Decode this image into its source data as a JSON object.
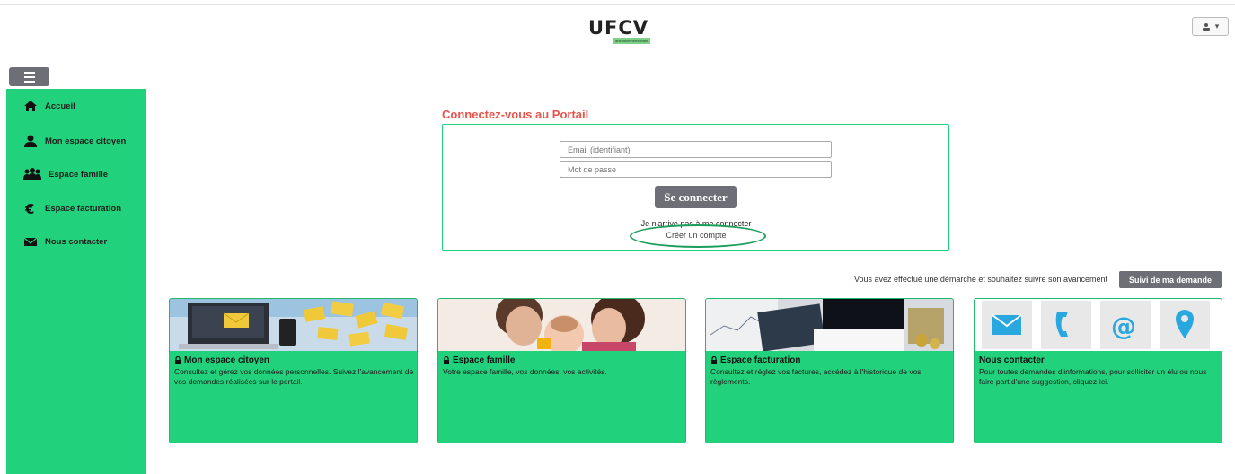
{
  "header": {
    "logo_text": "UFCV",
    "logo_sub": "animation territoriale",
    "user_menu_caret": "▾"
  },
  "sidebar": {
    "items": [
      {
        "label": "Accueil",
        "icon": "home-icon"
      },
      {
        "label": "Mon espace citoyen",
        "icon": "user-icon"
      },
      {
        "label": "Espace famille",
        "icon": "family-icon"
      },
      {
        "label": "Espace facturation",
        "icon": "euro-icon"
      },
      {
        "label": "Nous contacter",
        "icon": "envelope-icon"
      }
    ]
  },
  "login": {
    "title": "Connectez-vous au Portail",
    "email_placeholder": "Email (identifiant)",
    "password_placeholder": "Mot de passe",
    "connect_label": "Se connecter",
    "forgot_label": "Je n'arrive pas à me connecter",
    "create_account_label": "Créer un compte"
  },
  "tracking": {
    "text": "Vous avez effectué une démarche et souhaitez suivre son avancement",
    "button_label": "Suivi de ma demande"
  },
  "cards": [
    {
      "title": "Mon espace citoyen",
      "text": "Consultez et gérez vos données personnelles. Suivez l'avancement de vos demandes réalisées sur le portail.",
      "locked": true
    },
    {
      "title": "Espace famille",
      "text": "Votre espace famille, vos données, vos activités.",
      "locked": true
    },
    {
      "title": "Espace facturation",
      "text": "Consultez et réglez vos factures, accédez à l'historique de vos règlements.",
      "locked": true
    },
    {
      "title": "Nous contacter",
      "text": "Pour toutes demandes d'informations, pour solliciter un élu ou nous faire part d'une suggestion, cliquez-ici.",
      "locked": false
    }
  ],
  "colors": {
    "brand_green": "#22d17b",
    "title_red": "#e8544c",
    "button_gray": "#6e6e76"
  }
}
